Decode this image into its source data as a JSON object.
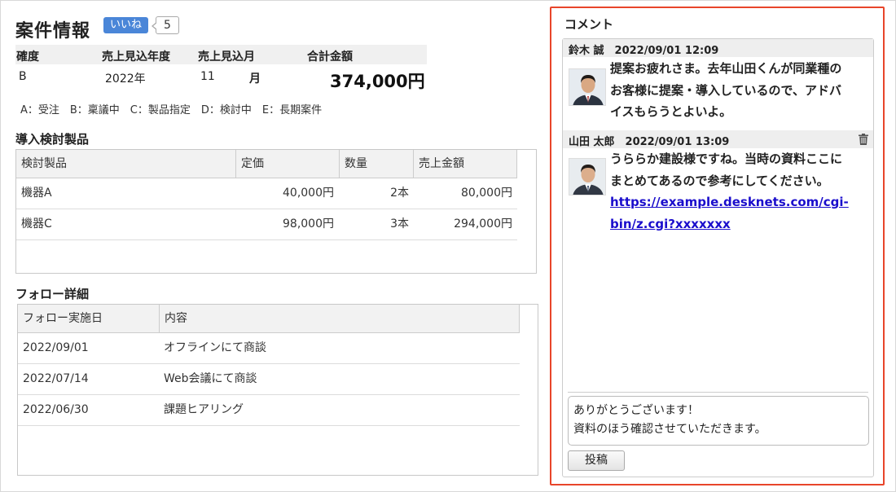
{
  "header": {
    "title": "案件情報",
    "like_label": "いいね",
    "like_count": "5"
  },
  "info": {
    "headers": [
      "確度",
      "売上見込年度",
      "売上見込月",
      "合計金額"
    ],
    "values": {
      "rank": "B",
      "year": "2022年",
      "month": "11",
      "month_unit": "月",
      "amount": "374,000円"
    },
    "legend": "A：受注　B：稟議中　C：製品指定　D：検討中　E：長期案件"
  },
  "products": {
    "section_title": "導入検討製品",
    "columns": [
      "検討製品",
      "定価",
      "数量",
      "売上金額"
    ],
    "rows": [
      [
        "機器A",
        "40,000円",
        "2本",
        "80,000円"
      ],
      [
        "機器C",
        "98,000円",
        "3本",
        "294,000円"
      ]
    ]
  },
  "follow": {
    "section_title": "フォロー詳細",
    "columns": [
      "フォロー実施日",
      "内容"
    ],
    "rows": [
      [
        "2022/09/01",
        "オフラインにて商談"
      ],
      [
        "2022/07/14",
        "Web会議にて商談"
      ],
      [
        "2022/06/30",
        "課題ヒアリング"
      ]
    ]
  },
  "comments": {
    "title": "コメント",
    "items": [
      {
        "header": "鈴木 誠　2022/09/01 12:09",
        "lines": [
          "提案お疲れさま。去年山田くんが同業種の",
          "お客様に提案・導入しているので、アドバ",
          "イスもらうとよいよ。"
        ],
        "icon": "person-avatar"
      },
      {
        "header": "山田 太郎　2022/09/01 13:09",
        "lines": [
          "うららか建設様ですね。当時の資料ここに",
          "まとめてあるので参考にしてください。"
        ],
        "link_lines": [
          "https://example.desknets.com/cgi-",
          "bin/z.cgi?xxxxxxx"
        ],
        "icon": "person-avatar",
        "delete_icon": "trash-icon"
      }
    ],
    "input_value": "ありがとうございます！\n資料のほう確認させていただきます。",
    "post_label": "投稿"
  },
  "colors": {
    "highlight_border": "#e8452a",
    "like_button": "#4a86d8",
    "link": "#1a0dcc"
  }
}
